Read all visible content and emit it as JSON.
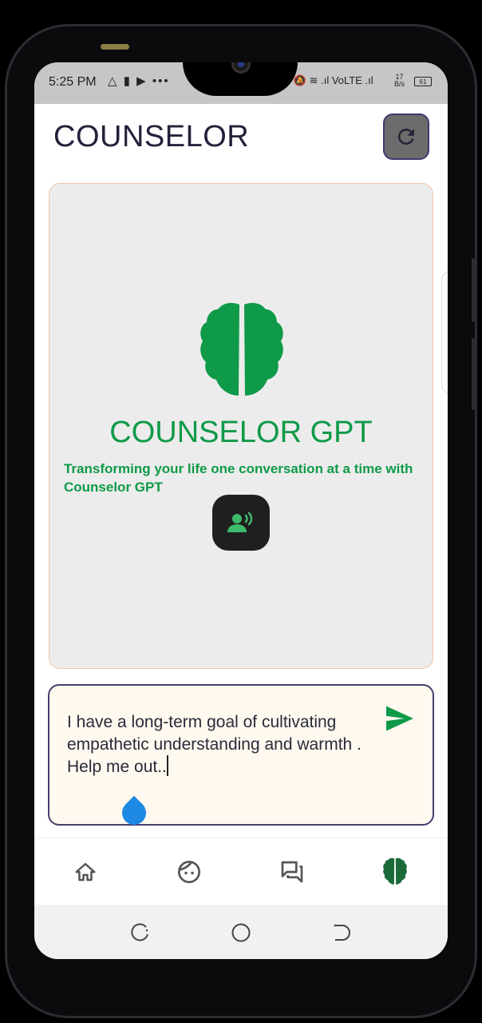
{
  "status_bar": {
    "time": "5:25 PM",
    "left_icons": "△ ▮ ▶ •••",
    "right_icons": "⏰ 🔕 ≋ .ıl VoLTE .ıl",
    "speed_value": "17",
    "speed_unit": "B/s",
    "battery": "61"
  },
  "header": {
    "title": "COUNSELOR",
    "refresh_icon": "refresh-icon"
  },
  "hero": {
    "logo_icon": "brain-icon",
    "title": "COUNSELOR GPT",
    "subtitle": "Transforming your life one conversation at a time with Counselor GPT",
    "voice_icon": "record-voice-icon"
  },
  "composer": {
    "text": "I have a long-term goal of cultivating empathetic understanding and warmth . Help me out..",
    "send_icon": "send-icon"
  },
  "bottom_nav": {
    "items": [
      {
        "icon": "home-icon"
      },
      {
        "icon": "face-icon"
      },
      {
        "icon": "forum-icon"
      },
      {
        "icon": "brain-icon"
      }
    ]
  },
  "system_nav": [
    "recents-icon",
    "home-circle-icon",
    "back-icon"
  ],
  "colors": {
    "brand_green": "#0e9a48",
    "card_bg": "#ececec",
    "composer_border": "#473d6e",
    "composer_bg": "#fff9ef",
    "caret_handle": "#1e88e5"
  }
}
